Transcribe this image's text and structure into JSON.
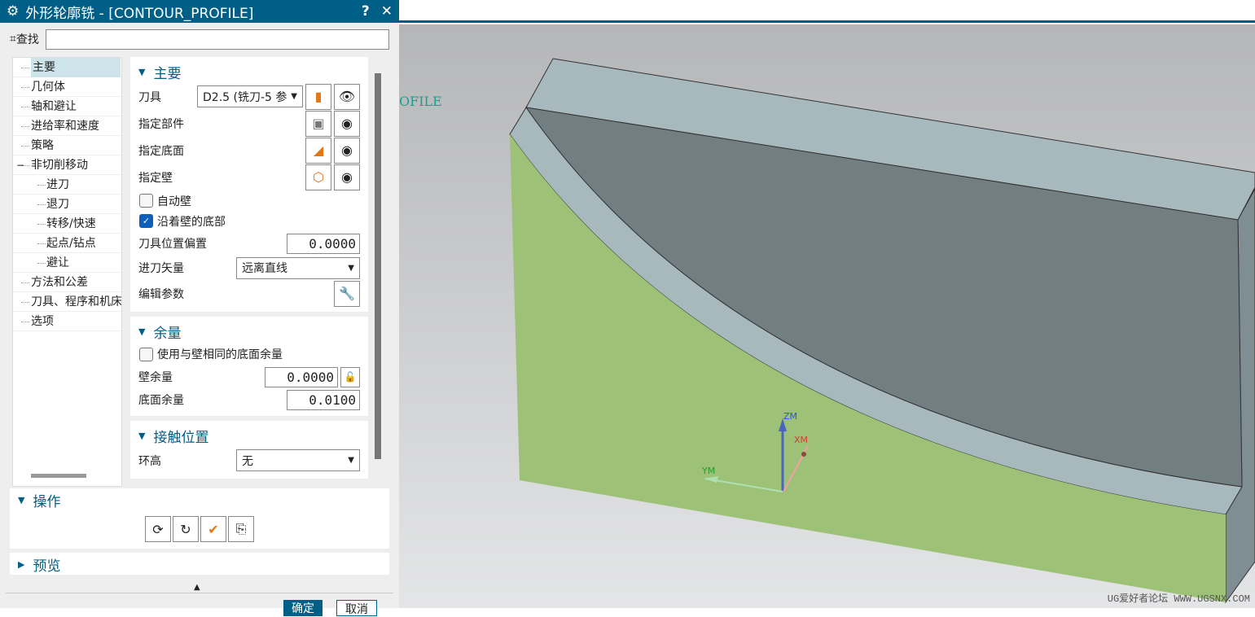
{
  "dialog": {
    "title": "外形轮廓铣 - [CONTOUR_PROFILE]",
    "help": "?",
    "close": "✕",
    "find_label": "查找",
    "find_value": ""
  },
  "tree": {
    "items": [
      {
        "label": "主要"
      },
      {
        "label": "几何体"
      },
      {
        "label": "轴和避让"
      },
      {
        "label": "进给率和速度"
      },
      {
        "label": "策略"
      },
      {
        "label": "非切削移动",
        "expander": "−"
      },
      {
        "label": "进刀"
      },
      {
        "label": "退刀"
      },
      {
        "label": "转移/快速"
      },
      {
        "label": "起点/钻点"
      },
      {
        "label": "避让"
      },
      {
        "label": "方法和公差"
      },
      {
        "label": "刀具、程序和机床"
      },
      {
        "label": "选项"
      }
    ]
  },
  "main": {
    "header": "主要",
    "tool_label": "刀具",
    "tool_value": "D2.5 (铣刀-5 参",
    "part_label": "指定部件",
    "floor_label": "指定底面",
    "wall_label": "指定壁",
    "auto_wall": "自动壁",
    "follow_floor": "沿着壁的底部",
    "offset_label": "刀具位置偏置",
    "offset_value": "0.0000",
    "vector_label": "进刀矢量",
    "vector_value": "远离直线",
    "edit_label": "编辑参数"
  },
  "stock": {
    "header": "余量",
    "same_label": "使用与壁相同的底面余量",
    "wall_label": "壁余量",
    "wall_value": "0.0000",
    "floor_label": "底面余量",
    "floor_value": "0.0100"
  },
  "contact": {
    "header": "接触位置",
    "ring_label": "环高",
    "ring_value": "无"
  },
  "ops": {
    "header": "操作"
  },
  "preview": {
    "header": "预览"
  },
  "buttons": {
    "ok": "确定",
    "cancel": "取消"
  },
  "viewport": {
    "op_name": "OFILE",
    "axes": {
      "z": "ZM",
      "x": "XM",
      "y": "YM"
    },
    "watermark": "UG爱好者论坛 WWW.UGSNX.COM"
  },
  "colors": {
    "accent": "#005f87",
    "green_face": "#9dc177",
    "light_face": "#a8b9bd",
    "dark_face": "#727f82"
  }
}
